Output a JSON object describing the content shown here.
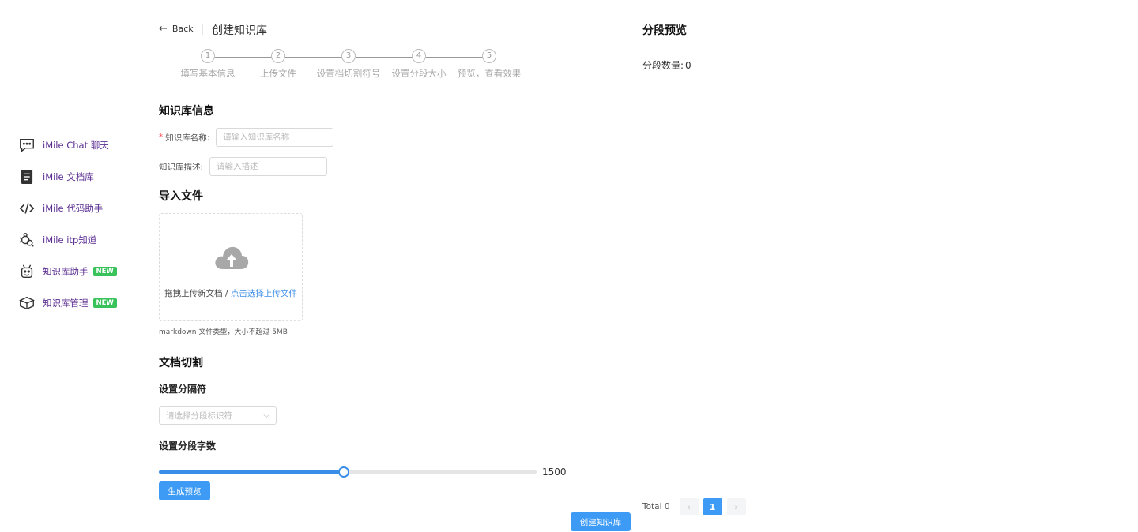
{
  "sidebar": {
    "items": [
      {
        "label": "iMile Chat 聊天",
        "icon": "chat-bubble-icon",
        "badge": ""
      },
      {
        "label": "iMile 文档库",
        "icon": "document-icon",
        "badge": ""
      },
      {
        "label": "iMile 代码助手",
        "icon": "code-icon",
        "badge": ""
      },
      {
        "label": "iMile itp知道",
        "icon": "search-bug-icon",
        "badge": ""
      },
      {
        "label": "知识库助手",
        "icon": "robot-icon",
        "badge": "NEW"
      },
      {
        "label": "知识库管理",
        "icon": "box-icon",
        "badge": "NEW"
      }
    ]
  },
  "header": {
    "back_label": "Back",
    "title": "创建知识库"
  },
  "steps": [
    {
      "number": "1",
      "label": "填写基本信息"
    },
    {
      "number": "2",
      "label": "上传文件"
    },
    {
      "number": "3",
      "label": "设置档切割符号"
    },
    {
      "number": "4",
      "label": "设置分段大小"
    },
    {
      "number": "5",
      "label": "预览，查看效果"
    }
  ],
  "info_section": {
    "title": "知识库信息",
    "name_label": "知识库名称:",
    "name_placeholder": "请输入知识库名称",
    "desc_label": "知识库描述:",
    "desc_placeholder": "请输入描述"
  },
  "import_section": {
    "title": "导入文件",
    "drag_text": "拖拽上传新文档 / ",
    "select_link": "点击选择上传文件",
    "hint": "markdown 文件类型，大小不超过 5MB"
  },
  "split_section": {
    "title": "文档切割",
    "separator_title": "设置分隔符",
    "separator_placeholder": "请选择分段标识符",
    "size_title": "设置分段字数",
    "slider_value": "1500",
    "slider_fraction": 0.49,
    "generate_button": "生成预览"
  },
  "create_button": "创建知识库",
  "preview": {
    "title": "分段预览",
    "count_label": "分段数量:",
    "count_value": "0"
  },
  "pagination": {
    "total": "Total 0",
    "prev": "‹",
    "current": "1",
    "next": "›"
  },
  "colors": {
    "accent": "#3d9bf5",
    "nav_text": "#5b2d91",
    "badge": "#37c25a"
  }
}
